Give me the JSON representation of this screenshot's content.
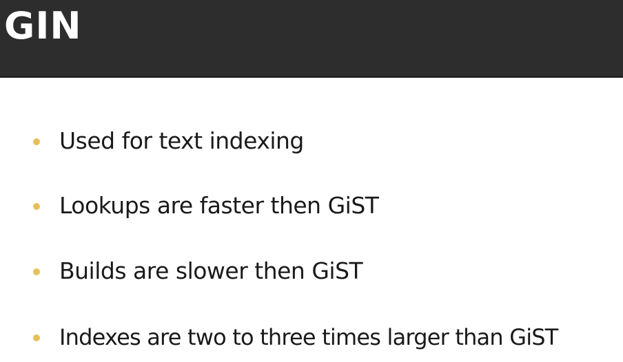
{
  "slide": {
    "title": "GIN",
    "accent_color": "#e5c05a",
    "header_color": "#2d2d2d"
  },
  "bullets": [
    "Used for text indexing",
    "Lookups are faster then GiST",
    "Builds are slower then GiST",
    "Indexes are two to three times larger than GiST"
  ]
}
